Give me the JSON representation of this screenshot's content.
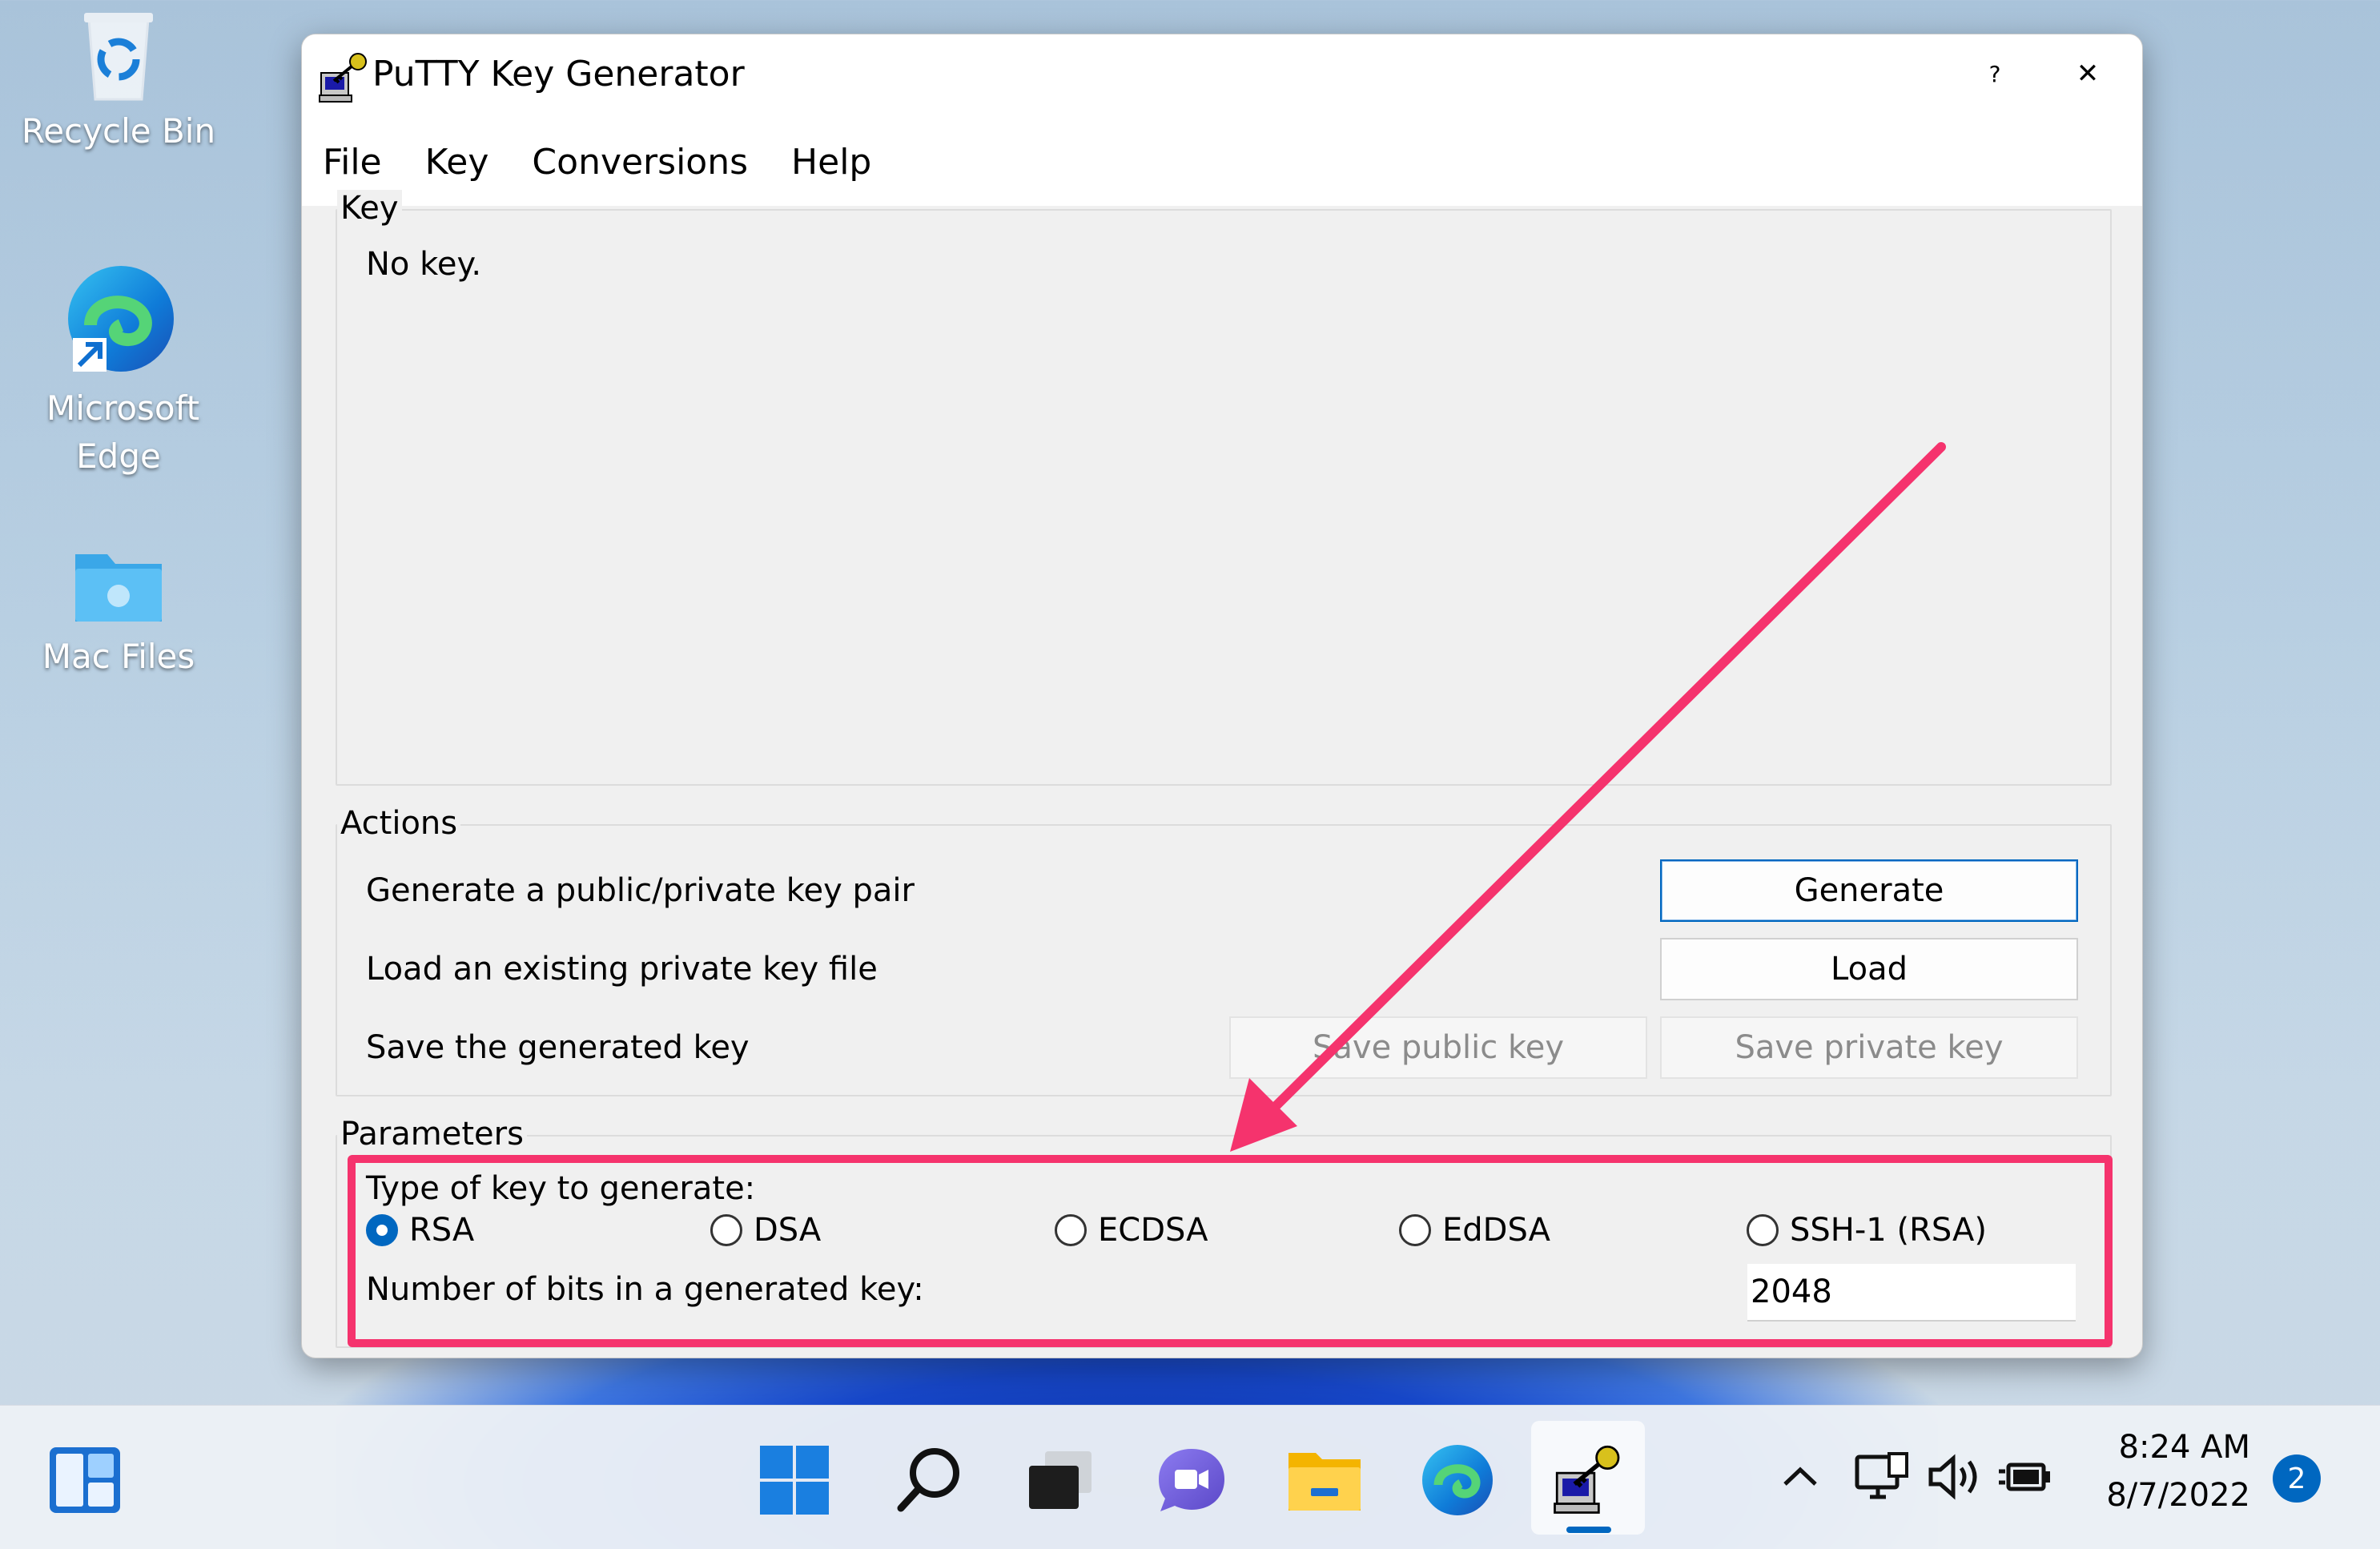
{
  "desktop": {
    "icons": [
      {
        "label": "Recycle Bin",
        "icon": "recycle-bin-icon"
      },
      {
        "label": "Microsoft Edge",
        "icon": "edge-icon"
      },
      {
        "label": "Mac Files",
        "icon": "folder-icon"
      }
    ]
  },
  "window": {
    "title": "PuTTY Key Generator",
    "help_button": "?",
    "close_button": "✕",
    "menu": [
      "File",
      "Key",
      "Conversions",
      "Help"
    ]
  },
  "key_group": {
    "label": "Key",
    "status": "No key."
  },
  "actions_group": {
    "label": "Actions",
    "generate_text": "Generate a public/private key pair",
    "generate_button": "Generate",
    "load_text": "Load an existing private key file",
    "load_button": "Load",
    "save_text": "Save the generated key",
    "save_public_button": "Save public key",
    "save_private_button": "Save private key"
  },
  "parameters_group": {
    "label": "Parameters",
    "type_label": "Type of key to generate:",
    "key_types": [
      {
        "label": "RSA",
        "selected": true
      },
      {
        "label": "DSA",
        "selected": false
      },
      {
        "label": "ECDSA",
        "selected": false
      },
      {
        "label": "EdDSA",
        "selected": false
      },
      {
        "label": "SSH-1 (RSA)",
        "selected": false
      }
    ],
    "bits_label": "Number of bits in a generated key:",
    "bits_value": "2048"
  },
  "annotation": {
    "color": "#f5336d"
  },
  "taskbar": {
    "items": [
      "widgets-icon",
      "start-icon",
      "search-icon",
      "task-view-icon",
      "chat-icon",
      "file-explorer-icon",
      "edge-icon",
      "puttygen-icon"
    ],
    "time": "8:24 AM",
    "date": "8/7/2022",
    "notification_count": "2"
  }
}
